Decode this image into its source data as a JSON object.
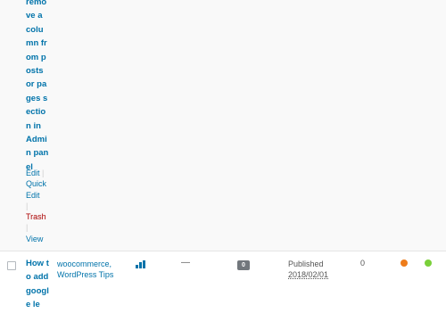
{
  "row1": {
    "title_fragment": "remove a column from posts or pages section in Admin panel",
    "actions": {
      "edit": "Edit",
      "quick_edit": "Quick Edit",
      "trash": "Trash",
      "view": "View",
      "sep": "|"
    }
  },
  "row2": {
    "title": "How to add google le",
    "categories": "woocommerce, WordPress Tips",
    "tags": "—",
    "comments": "0",
    "status": "Published",
    "date": "2018/02/01",
    "count": "0",
    "seo_score_color": "#ee7c1b",
    "readability_color": "#7ad03a",
    "stats_icon": "bar-chart-icon"
  }
}
